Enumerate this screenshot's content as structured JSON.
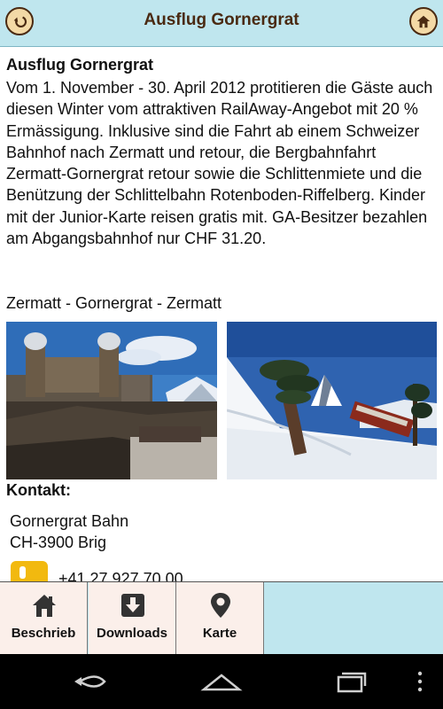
{
  "header": {
    "title": "Ausflug Gornergrat",
    "back_icon": "back-arrow-icon",
    "home_icon": "home-icon",
    "accent_color": "#bfe6ee",
    "button_color": "#f3d9a6"
  },
  "article": {
    "heading": "Ausflug Gornergrat",
    "description": "Vom 1. November - 30. April 2012 protitieren die Gäste auch diesen Winter vom attraktiven RailAway-Angebot mit 20 % Ermässigung. Inklusive sind die Fahrt ab einem Schweizer Bahnhof nach Zermatt und retour, die Bergbahnfahrt Zermatt-Gornergrat retour sowie die Schlittenmiete und die Benützung der Schlittelbahn Rotenboden-Riffelberg. Kinder mit der Junior-Karte reisen gratis mit. GA-Besitzer bezahlen am Abgangsbahnhof nur CHF 31.20.",
    "route": "Zermatt - Gornergrat - Zermatt"
  },
  "contact": {
    "heading": "Kontakt:",
    "line1": "Gornergrat Bahn",
    "line2": "CH-3900 Brig",
    "phone": "+41 27 927 70 00",
    "phone_icon": "phone-icon"
  },
  "tabs": [
    {
      "label": "Beschrieb",
      "icon": "house-icon"
    },
    {
      "label": "Downloads",
      "icon": "download-icon"
    },
    {
      "label": "Karte",
      "icon": "map-pin-icon"
    }
  ],
  "system_nav": {
    "back_icon": "nav-back-icon",
    "home_icon": "nav-home-icon",
    "recent_icon": "nav-recent-apps-icon",
    "menu_icon": "nav-menu-icon"
  }
}
